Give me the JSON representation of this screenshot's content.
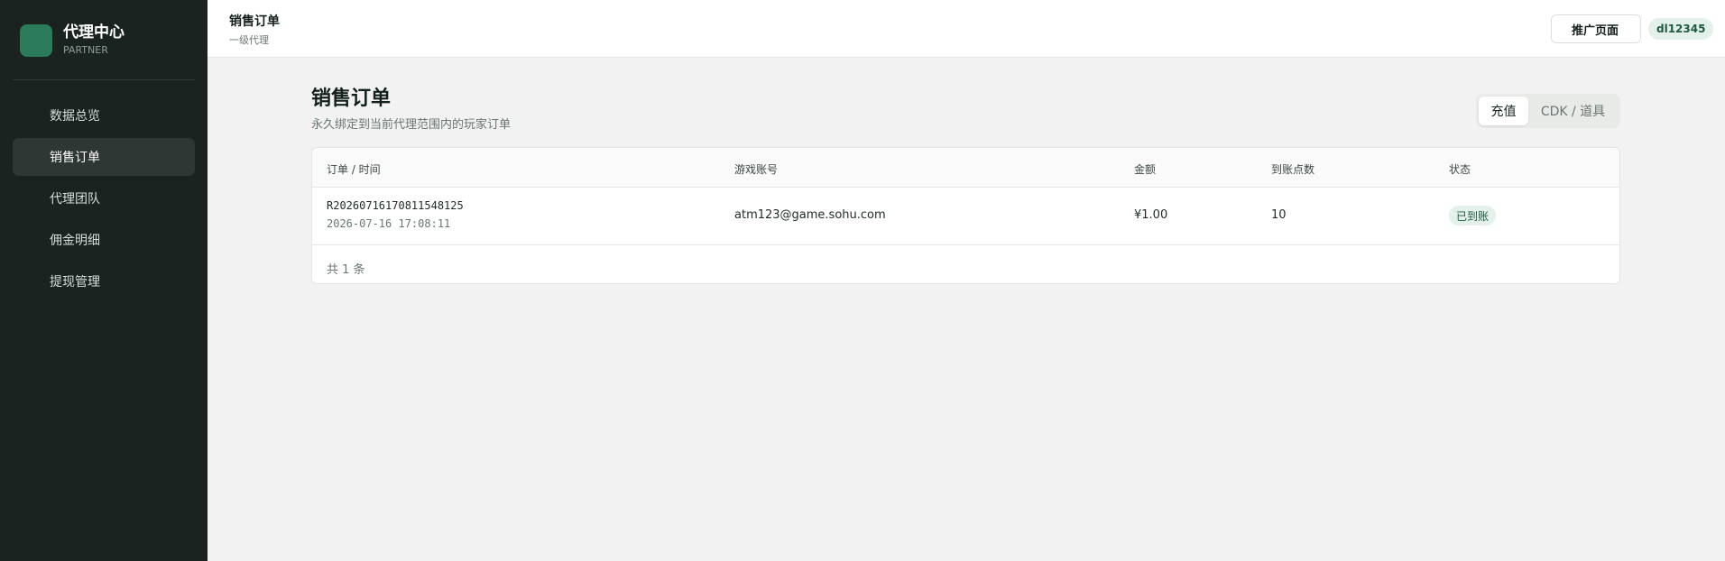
{
  "sidebar": {
    "brand_title": "代理中心",
    "brand_sub": "PARTNER",
    "items": [
      {
        "label": "数据总览",
        "active": false
      },
      {
        "label": "销售订单",
        "active": true
      },
      {
        "label": "代理团队",
        "active": false
      },
      {
        "label": "佣金明细",
        "active": false
      },
      {
        "label": "提现管理",
        "active": false
      }
    ]
  },
  "header": {
    "title": "销售订单",
    "subtitle": "一级代理",
    "promo_label": "推广页面",
    "user": "dl12345"
  },
  "page": {
    "title": "销售订单",
    "description": "永久绑定到当前代理范围内的玩家订单"
  },
  "tabs": {
    "active": "充值",
    "other": "CDK / 道具"
  },
  "table": {
    "columns": [
      "订单 / 时间",
      "游戏账号",
      "金额",
      "到账点数",
      "状态"
    ],
    "rows": [
      {
        "order_id": "R20260716170811548125",
        "time": "2026-07-16 17:08:11",
        "account": "atm123@game.sohu.com",
        "amount": "¥1.00",
        "points": "10",
        "status": "已到账"
      }
    ],
    "footer": "共 1 条"
  },
  "colors": {
    "sidebar_bg": "#1a2320",
    "brand_accent": "#2b7a5a",
    "status_bg": "#e3f1ea",
    "status_text": "#1d5a43"
  }
}
